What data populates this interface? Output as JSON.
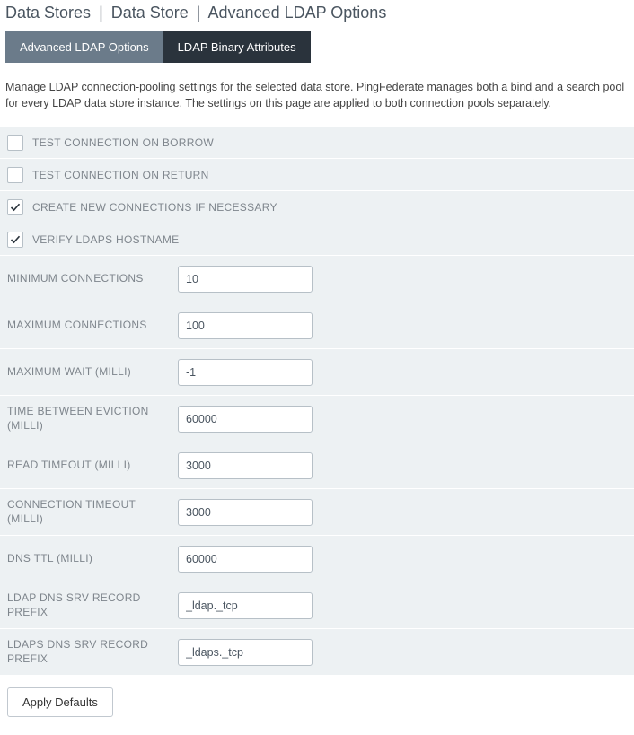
{
  "breadcrumb": {
    "items": [
      "Data Stores",
      "Data Store",
      "Advanced LDAP Options"
    ]
  },
  "tabs": [
    {
      "label": "Advanced LDAP Options",
      "active": true
    },
    {
      "label": "LDAP Binary Attributes",
      "active": false
    }
  ],
  "description": "Manage LDAP connection-pooling settings for the selected data store. PingFederate manages both a bind and a search pool for every LDAP data store instance. The settings on this page are applied to both connection pools separately.",
  "checkboxes": [
    {
      "name": "test-on-borrow",
      "label": "TEST CONNECTION ON BORROW",
      "checked": false
    },
    {
      "name": "test-on-return",
      "label": "TEST CONNECTION ON RETURN",
      "checked": false
    },
    {
      "name": "create-if-necessary",
      "label": "CREATE NEW CONNECTIONS IF NECESSARY",
      "checked": true
    },
    {
      "name": "verify-ldaps-hostname",
      "label": "VERIFY LDAPS HOSTNAME",
      "checked": true
    }
  ],
  "fields": [
    {
      "name": "minimum-connections",
      "label": "MINIMUM CONNECTIONS",
      "value": "10"
    },
    {
      "name": "maximum-connections",
      "label": "MAXIMUM CONNECTIONS",
      "value": "100"
    },
    {
      "name": "maximum-wait",
      "label": "MAXIMUM WAIT (MILLI)",
      "value": "-1"
    },
    {
      "name": "time-between-eviction",
      "label": "TIME BETWEEN EVICTION (MILLI)",
      "value": "60000"
    },
    {
      "name": "read-timeout",
      "label": "READ TIMEOUT (MILLI)",
      "value": "3000"
    },
    {
      "name": "connection-timeout",
      "label": "CONNECTION TIMEOUT (MILLI)",
      "value": "3000"
    },
    {
      "name": "dns-ttl",
      "label": "DNS TTL (MILLI)",
      "value": "60000"
    },
    {
      "name": "ldap-dns-srv-prefix",
      "label": "LDAP DNS SRV RECORD PREFIX",
      "value": "_ldap._tcp"
    },
    {
      "name": "ldaps-dns-srv-prefix",
      "label": "LDAPS DNS SRV RECORD PREFIX",
      "value": "_ldaps._tcp"
    }
  ],
  "buttons": {
    "apply_defaults": "Apply Defaults"
  }
}
